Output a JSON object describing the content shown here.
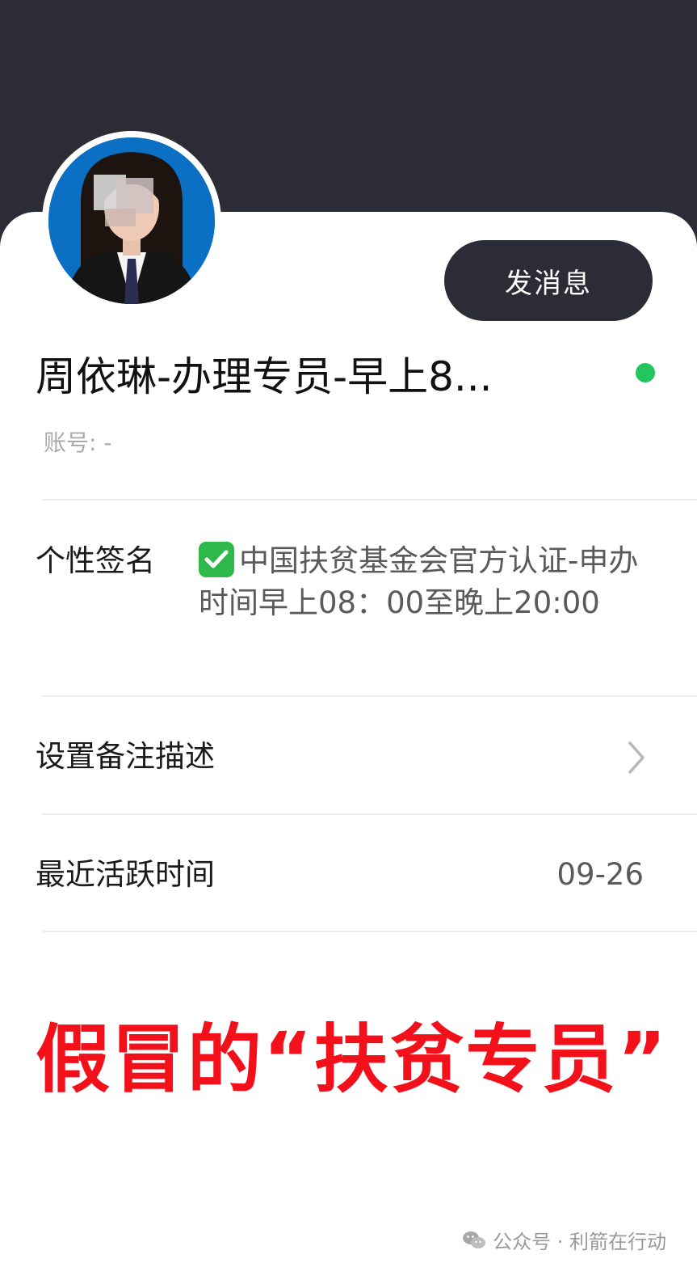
{
  "profile": {
    "name": "周依琳-办理专员-早上8...",
    "account": "账号: -",
    "send_button": "发消息",
    "online_status_color": "#22c55e"
  },
  "signature": {
    "label": "个性签名",
    "icon": "green-check-icon",
    "text": "中国扶贫基金会官方认证-申办时间早上08：00至晚上20:00"
  },
  "remark": {
    "label": "设置备注描述",
    "icon": "chevron-right-icon"
  },
  "last_active": {
    "label": "最近活跃时间",
    "value": "09-26"
  },
  "overlay_caption": "假冒的“扶贫专员”",
  "watermark": {
    "icon": "wechat-icon",
    "text": "公众号 · 利箭在行动"
  },
  "colors": {
    "header_bg": "#2c2c36",
    "overlay_red": "#f2111b",
    "check_green": "#2fb84a"
  }
}
